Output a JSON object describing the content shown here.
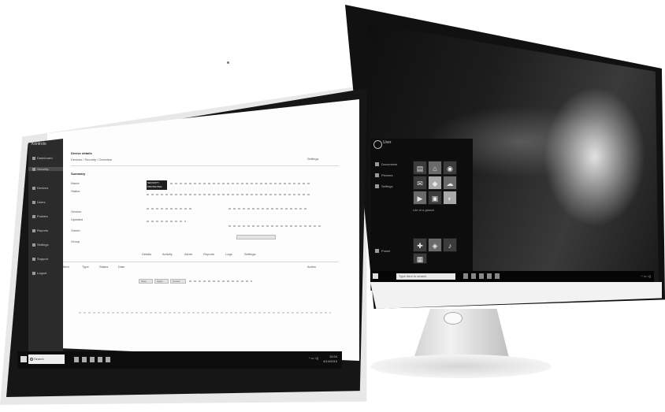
{
  "right_monitor": {
    "start_menu": {
      "user_label": "User",
      "items": [
        "Documents",
        "Pictures",
        "Settings",
        "Power"
      ],
      "tile_glyphs": [
        "▤",
        "⌂",
        "◉",
        "✉",
        "◆",
        "☁",
        "▶",
        "▣",
        "◐",
        "✚",
        "◈",
        "♪",
        "▦"
      ],
      "group_label": "Life at a glance"
    },
    "taskbar": {
      "search_placeholder": "Type here to search",
      "tray": "^ ▭ ◁)"
    }
  },
  "laptop": {
    "app_brand": "Kontrolo",
    "sidebar_items": [
      "Dashboard",
      "Security",
      "Devices",
      "Users",
      "Policies",
      "Reports",
      "Settings",
      "Support",
      "Logout"
    ],
    "header": {
      "title": "Device details",
      "breadcrumb": "Devices / Security / Overview",
      "action_label": "Settings"
    },
    "summary": {
      "heading": "Summary",
      "badge_line1": "SECURITY",
      "badge_line2": "PROTECTED",
      "fields": [
        "Name",
        "Status",
        "Version",
        "Updated",
        "Owner",
        "Group"
      ]
    },
    "tabs": [
      "Details",
      "Activity",
      "Alerts",
      "Reports",
      "Logs",
      "Settings"
    ],
    "table_headers": [
      "Item",
      "Type",
      "Status",
      "Date",
      "Action"
    ],
    "footer_buttons": [
      "Save",
      "Apply",
      "Cancel"
    ],
    "taskbar": {
      "search_placeholder": "Search",
      "tray": "^ ▭ ◁)",
      "clock_time": "10:24",
      "clock_date": "4/14/2019"
    }
  }
}
